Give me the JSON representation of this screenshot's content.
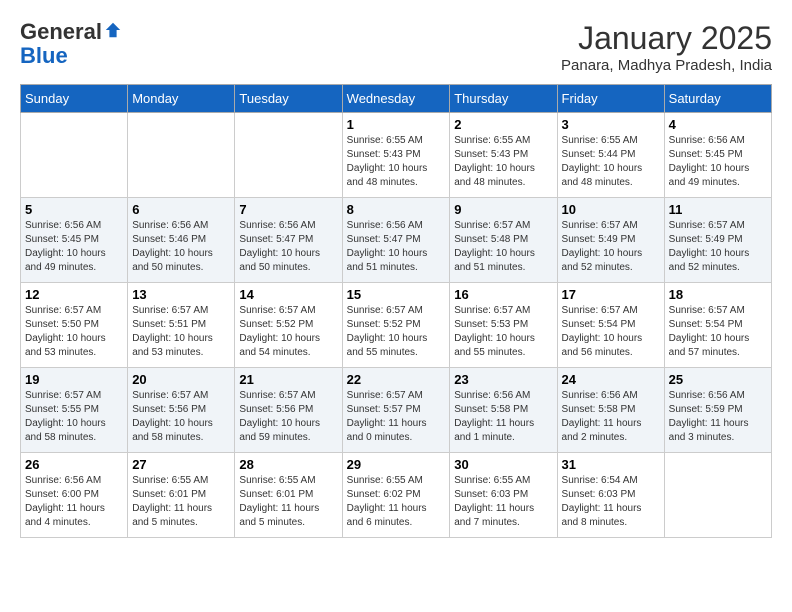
{
  "header": {
    "logo_general": "General",
    "logo_blue": "Blue",
    "month_title": "January 2025",
    "location": "Panara, Madhya Pradesh, India"
  },
  "weekdays": [
    "Sunday",
    "Monday",
    "Tuesday",
    "Wednesday",
    "Thursday",
    "Friday",
    "Saturday"
  ],
  "weeks": [
    [
      {
        "day": "",
        "info": ""
      },
      {
        "day": "",
        "info": ""
      },
      {
        "day": "",
        "info": ""
      },
      {
        "day": "1",
        "info": "Sunrise: 6:55 AM\nSunset: 5:43 PM\nDaylight: 10 hours\nand 48 minutes."
      },
      {
        "day": "2",
        "info": "Sunrise: 6:55 AM\nSunset: 5:43 PM\nDaylight: 10 hours\nand 48 minutes."
      },
      {
        "day": "3",
        "info": "Sunrise: 6:55 AM\nSunset: 5:44 PM\nDaylight: 10 hours\nand 48 minutes."
      },
      {
        "day": "4",
        "info": "Sunrise: 6:56 AM\nSunset: 5:45 PM\nDaylight: 10 hours\nand 49 minutes."
      }
    ],
    [
      {
        "day": "5",
        "info": "Sunrise: 6:56 AM\nSunset: 5:45 PM\nDaylight: 10 hours\nand 49 minutes."
      },
      {
        "day": "6",
        "info": "Sunrise: 6:56 AM\nSunset: 5:46 PM\nDaylight: 10 hours\nand 50 minutes."
      },
      {
        "day": "7",
        "info": "Sunrise: 6:56 AM\nSunset: 5:47 PM\nDaylight: 10 hours\nand 50 minutes."
      },
      {
        "day": "8",
        "info": "Sunrise: 6:56 AM\nSunset: 5:47 PM\nDaylight: 10 hours\nand 51 minutes."
      },
      {
        "day": "9",
        "info": "Sunrise: 6:57 AM\nSunset: 5:48 PM\nDaylight: 10 hours\nand 51 minutes."
      },
      {
        "day": "10",
        "info": "Sunrise: 6:57 AM\nSunset: 5:49 PM\nDaylight: 10 hours\nand 52 minutes."
      },
      {
        "day": "11",
        "info": "Sunrise: 6:57 AM\nSunset: 5:49 PM\nDaylight: 10 hours\nand 52 minutes."
      }
    ],
    [
      {
        "day": "12",
        "info": "Sunrise: 6:57 AM\nSunset: 5:50 PM\nDaylight: 10 hours\nand 53 minutes."
      },
      {
        "day": "13",
        "info": "Sunrise: 6:57 AM\nSunset: 5:51 PM\nDaylight: 10 hours\nand 53 minutes."
      },
      {
        "day": "14",
        "info": "Sunrise: 6:57 AM\nSunset: 5:52 PM\nDaylight: 10 hours\nand 54 minutes."
      },
      {
        "day": "15",
        "info": "Sunrise: 6:57 AM\nSunset: 5:52 PM\nDaylight: 10 hours\nand 55 minutes."
      },
      {
        "day": "16",
        "info": "Sunrise: 6:57 AM\nSunset: 5:53 PM\nDaylight: 10 hours\nand 55 minutes."
      },
      {
        "day": "17",
        "info": "Sunrise: 6:57 AM\nSunset: 5:54 PM\nDaylight: 10 hours\nand 56 minutes."
      },
      {
        "day": "18",
        "info": "Sunrise: 6:57 AM\nSunset: 5:54 PM\nDaylight: 10 hours\nand 57 minutes."
      }
    ],
    [
      {
        "day": "19",
        "info": "Sunrise: 6:57 AM\nSunset: 5:55 PM\nDaylight: 10 hours\nand 58 minutes."
      },
      {
        "day": "20",
        "info": "Sunrise: 6:57 AM\nSunset: 5:56 PM\nDaylight: 10 hours\nand 58 minutes."
      },
      {
        "day": "21",
        "info": "Sunrise: 6:57 AM\nSunset: 5:56 PM\nDaylight: 10 hours\nand 59 minutes."
      },
      {
        "day": "22",
        "info": "Sunrise: 6:57 AM\nSunset: 5:57 PM\nDaylight: 11 hours\nand 0 minutes."
      },
      {
        "day": "23",
        "info": "Sunrise: 6:56 AM\nSunset: 5:58 PM\nDaylight: 11 hours\nand 1 minute."
      },
      {
        "day": "24",
        "info": "Sunrise: 6:56 AM\nSunset: 5:58 PM\nDaylight: 11 hours\nand 2 minutes."
      },
      {
        "day": "25",
        "info": "Sunrise: 6:56 AM\nSunset: 5:59 PM\nDaylight: 11 hours\nand 3 minutes."
      }
    ],
    [
      {
        "day": "26",
        "info": "Sunrise: 6:56 AM\nSunset: 6:00 PM\nDaylight: 11 hours\nand 4 minutes."
      },
      {
        "day": "27",
        "info": "Sunrise: 6:55 AM\nSunset: 6:01 PM\nDaylight: 11 hours\nand 5 minutes."
      },
      {
        "day": "28",
        "info": "Sunrise: 6:55 AM\nSunset: 6:01 PM\nDaylight: 11 hours\nand 5 minutes."
      },
      {
        "day": "29",
        "info": "Sunrise: 6:55 AM\nSunset: 6:02 PM\nDaylight: 11 hours\nand 6 minutes."
      },
      {
        "day": "30",
        "info": "Sunrise: 6:55 AM\nSunset: 6:03 PM\nDaylight: 11 hours\nand 7 minutes."
      },
      {
        "day": "31",
        "info": "Sunrise: 6:54 AM\nSunset: 6:03 PM\nDaylight: 11 hours\nand 8 minutes."
      },
      {
        "day": "",
        "info": ""
      }
    ]
  ]
}
